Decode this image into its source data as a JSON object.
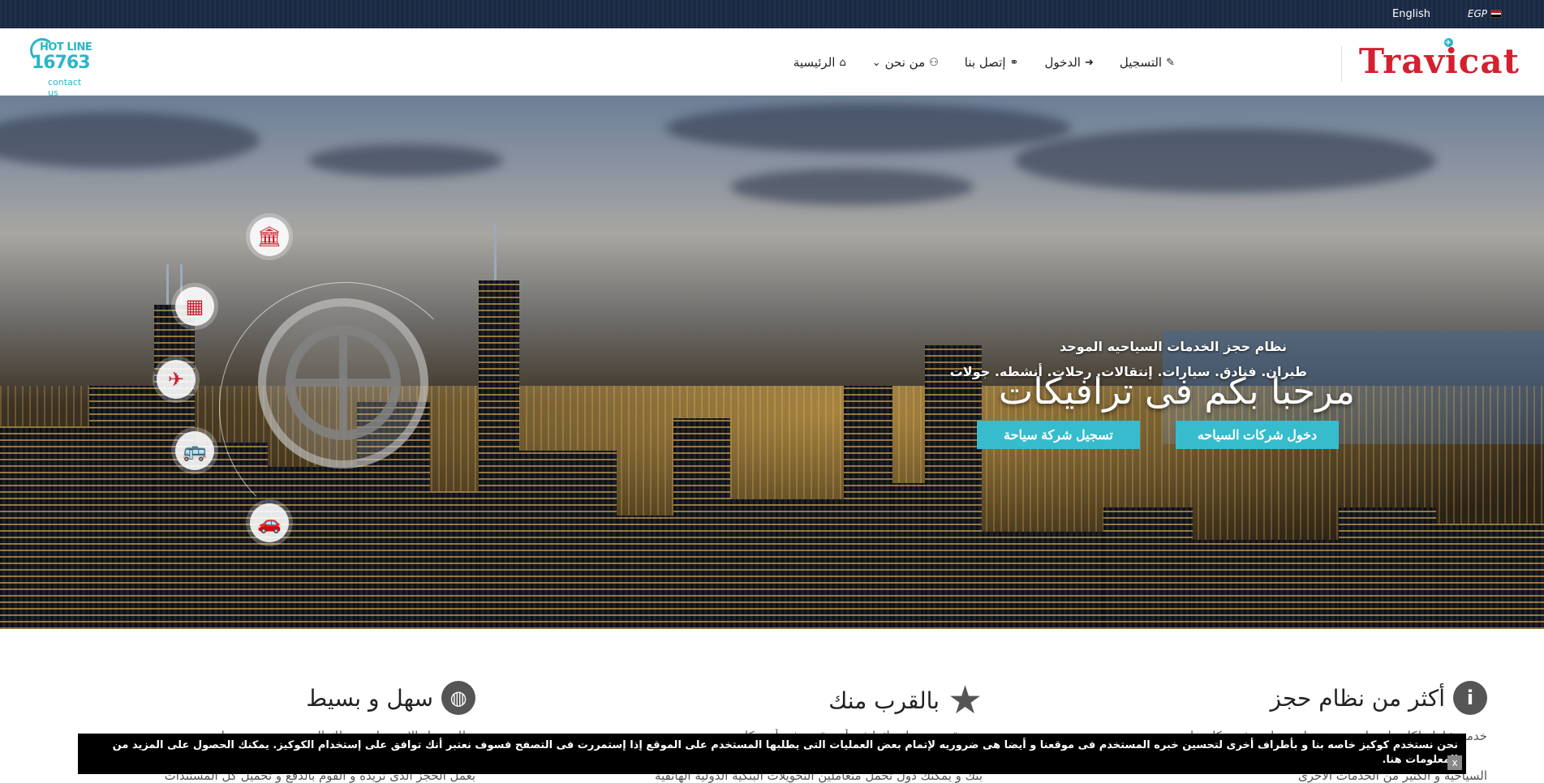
{
  "topbar": {
    "language": "English",
    "currency": "EGP",
    "flag_colors": [
      "#ce1126",
      "#ffffff",
      "#000000"
    ]
  },
  "header": {
    "hotline": {
      "top": "HOT LINE",
      "number": "16763",
      "sub": "contact us"
    },
    "brand": "Travicat",
    "nav": [
      {
        "label": "الرئيسية",
        "icon": "home-icon",
        "glyph": "⌂"
      },
      {
        "label": "من نحن",
        "icon": "users-icon",
        "glyph": "👥",
        "dropdown": "⌄"
      },
      {
        "label": "إتصل بنا",
        "icon": "headphones-icon",
        "glyph": "🎧"
      },
      {
        "label": "الدخول",
        "icon": "sign-in-icon",
        "glyph": "➜"
      },
      {
        "label": "التسجيل",
        "icon": "edit-icon",
        "glyph": "✎"
      }
    ]
  },
  "hero": {
    "title": "مرحبا بكم فى ترافيكات",
    "subtitle": "نظام حجز الخدمات السياحيه الموحد",
    "services": "طيران. فنادق. سيارات. إنتقالات. رحلات. أنشطه. جولات",
    "login_button": "دخول شركات السياحه",
    "register_button": "تسجيل شركة سياحة",
    "node_icons": [
      "bank-icon",
      "building-icon",
      "plane-icon",
      "bus-icon",
      "car-icon"
    ]
  },
  "features": [
    {
      "title": "أكثر من نظام حجز",
      "icon": "info-icon",
      "line1": "خدمة شاملة لكل ما تحتاجه من خدمات سياحية في مكان واحد",
      "line2": "السياحية و الكثير من الخدمات الأخرى"
    },
    {
      "title": "بالقرب منك",
      "icon": "star-icon",
      "line1": "نحن قريبون منك دائما في أي وقت وفي أي مكان",
      "line2": "بنك و يمكنك دول تحمل متعاملين التحويلات البنكية الدولية الهاتفية"
    },
    {
      "title": "سهل و بسيط",
      "icon": "globe-icon",
      "line1": "نظام سهل الاستخدام يتيح لك الحجز بسرعة وسهولة",
      "line2": "بعمل الحجز الذى تريده و القوم بالدفع و تحميل كل المستندات"
    }
  ],
  "cookie": {
    "text": "نحن نستخدم كوكيز خاصه بنا و بأطراف أخرى لتحسين خبره المستخدم فى موقعنا و أيضا هى ضروريه لإتمام بعض العمليات التى يطلبها المستخدم على الموقع إذا إستمررت فى التصفح فسوف نعتبر أنك توافق على إستخدام الكوكيز. يمكنك الحصول على المزيد من المعلومات هنا.",
    "close": "x"
  }
}
